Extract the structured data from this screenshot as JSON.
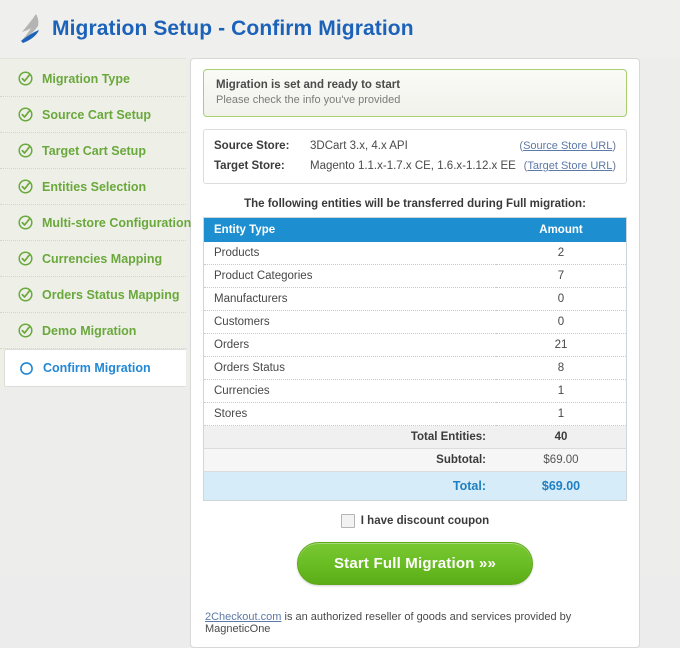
{
  "header": {
    "title": "Migration Setup - Confirm Migration",
    "logo_icon": "migration-bird-logo"
  },
  "sidebar": {
    "items": [
      {
        "label": "Migration Type",
        "state": "done",
        "icon": "check-circle-icon"
      },
      {
        "label": "Source Cart Setup",
        "state": "done",
        "icon": "check-circle-icon"
      },
      {
        "label": "Target Cart Setup",
        "state": "done",
        "icon": "check-circle-icon"
      },
      {
        "label": "Entities Selection",
        "state": "done",
        "icon": "check-circle-icon"
      },
      {
        "label": "Multi-store Configuration",
        "state": "done",
        "icon": "check-circle-icon"
      },
      {
        "label": "Currencies Mapping",
        "state": "done",
        "icon": "check-circle-icon"
      },
      {
        "label": "Orders Status Mapping",
        "state": "done",
        "icon": "check-circle-icon"
      },
      {
        "label": "Demo Migration",
        "state": "done",
        "icon": "check-circle-icon"
      },
      {
        "label": "Confirm Migration",
        "state": "active",
        "icon": "empty-circle-icon"
      }
    ]
  },
  "main": {
    "alert": {
      "title": "Migration is set and ready to start",
      "subtitle": "Please check the info you've provided"
    },
    "stores": {
      "source": {
        "label": "Source Store:",
        "value": "3DCart 3.x, 4.x API",
        "link": "Source Store URL",
        "link_prefix": "(",
        "link_suffix": ")"
      },
      "target": {
        "label": "Target Store:",
        "value": "Magento 1.1.x-1.7.x CE, 1.6.x-1.12.x EE",
        "link": "Target Store URL",
        "link_prefix": "(",
        "link_suffix": ")"
      }
    },
    "table_caption": "The following entities will be transferred during Full migration:",
    "table": {
      "columns": [
        "Entity Type",
        "Amount"
      ],
      "rows": [
        {
          "type": "Products",
          "amount": "2"
        },
        {
          "type": "Product Categories",
          "amount": "7"
        },
        {
          "type": "Manufacturers",
          "amount": "0"
        },
        {
          "type": "Customers",
          "amount": "0"
        },
        {
          "type": "Orders",
          "amount": "21"
        },
        {
          "type": "Orders Status",
          "amount": "8"
        },
        {
          "type": "Currencies",
          "amount": "1"
        },
        {
          "type": "Stores",
          "amount": "1"
        }
      ],
      "total_entities_label": "Total Entities:",
      "total_entities_value": "40",
      "subtotal_label": "Subtotal:",
      "subtotal_value": "$69.00",
      "total_label": "Total:",
      "total_value": "$69.00"
    },
    "coupon_label": "I have discount coupon",
    "coupon_checked": false,
    "start_button": "Start Full Migration »»",
    "reseller": {
      "link": "2Checkout.com",
      "text": " is an authorized reseller of goods and services provided by MagneticOne"
    }
  },
  "colors": {
    "title_blue": "#1b62b8",
    "sidebar_green": "#6aa83c",
    "active_blue": "#2288d6",
    "table_header_blue": "#1d8fd0",
    "total_row_bg": "#d6ecf9",
    "button_green": "#6bbd24",
    "alert_border_green": "#a8cf70"
  }
}
